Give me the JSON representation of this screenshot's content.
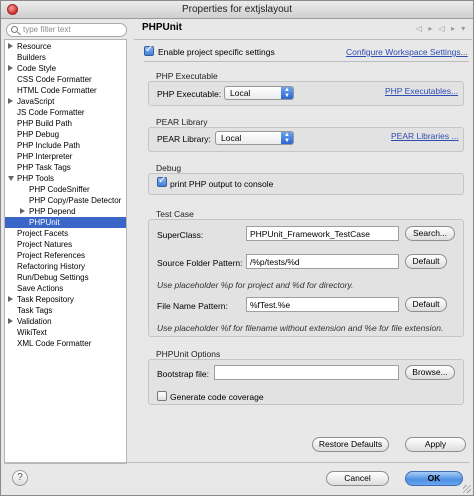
{
  "window": {
    "title": "Properties for extjslayout"
  },
  "filter": {
    "placeholder": "type filter text"
  },
  "tree": [
    {
      "label": "Resource",
      "twisty": "closed",
      "indent": 1
    },
    {
      "label": "Builders",
      "twisty": "",
      "indent": 1
    },
    {
      "label": "Code Style",
      "twisty": "closed",
      "indent": 1
    },
    {
      "label": "CSS Code Formatter",
      "twisty": "",
      "indent": 1
    },
    {
      "label": "HTML Code Formatter",
      "twisty": "",
      "indent": 1
    },
    {
      "label": "JavaScript",
      "twisty": "closed",
      "indent": 1
    },
    {
      "label": "JS Code Formatter",
      "twisty": "",
      "indent": 1
    },
    {
      "label": "PHP Build Path",
      "twisty": "",
      "indent": 1
    },
    {
      "label": "PHP Debug",
      "twisty": "",
      "indent": 1
    },
    {
      "label": "PHP Include Path",
      "twisty": "",
      "indent": 1
    },
    {
      "label": "PHP Interpreter",
      "twisty": "",
      "indent": 1
    },
    {
      "label": "PHP Task Tags",
      "twisty": "",
      "indent": 1
    },
    {
      "label": "PHP Tools",
      "twisty": "open",
      "indent": 1
    },
    {
      "label": "PHP CodeSniffer",
      "twisty": "",
      "indent": 2
    },
    {
      "label": "PHP Copy/Paste Detector",
      "twisty": "",
      "indent": 2
    },
    {
      "label": "PHP Depend",
      "twisty": "closed",
      "indent": 2
    },
    {
      "label": "PHPUnit",
      "twisty": "",
      "indent": 2,
      "selected": true
    },
    {
      "label": "Project Facets",
      "twisty": "",
      "indent": 1
    },
    {
      "label": "Project Natures",
      "twisty": "",
      "indent": 1
    },
    {
      "label": "Project References",
      "twisty": "",
      "indent": 1
    },
    {
      "label": "Refactoring History",
      "twisty": "",
      "indent": 1
    },
    {
      "label": "Run/Debug Settings",
      "twisty": "",
      "indent": 1
    },
    {
      "label": "Save Actions",
      "twisty": "",
      "indent": 1
    },
    {
      "label": "Task Repository",
      "twisty": "closed",
      "indent": 1
    },
    {
      "label": "Task Tags",
      "twisty": "",
      "indent": 1
    },
    {
      "label": "Validation",
      "twisty": "closed",
      "indent": 1
    },
    {
      "label": "WikiText",
      "twisty": "",
      "indent": 1
    },
    {
      "label": "XML Code Formatter",
      "twisty": "",
      "indent": 1
    }
  ],
  "page": {
    "title": "PHPUnit",
    "enable_specific": "Enable project specific settings",
    "configure_link": "Configure Workspace Settings...",
    "php_exec": {
      "group": "PHP Executable",
      "label": "PHP Executable:",
      "value": "Local",
      "link": "PHP Executables..."
    },
    "pear": {
      "group": "PEAR Library",
      "label": "PEAR Library:",
      "value": "Local",
      "link": "PEAR Libraries ..."
    },
    "debug": {
      "group": "Debug",
      "print_output": "print PHP output to console"
    },
    "test_case": {
      "group": "Test Case",
      "superclass_label": "SuperClass:",
      "superclass_value": "PHPUnit_Framework_TestCase",
      "search_button": "Search...",
      "source_folder_label": "Source Folder Pattern:",
      "source_folder_value": "/%p/tests/%d",
      "default_button_1": "Default",
      "source_hint": "Use placeholder %p for project and %d for directory.",
      "file_name_label": "File Name Pattern:",
      "file_name_value": "%fTest.%e",
      "default_button_2": "Default",
      "file_hint": "Use placeholder %f for filename without extension and %e for file extension."
    },
    "phpunit_options": {
      "group": "PHPUnit Options",
      "bootstrap_label": "Bootstrap file:",
      "bootstrap_value": "",
      "browse_button": "Browse...",
      "coverage": "Generate code coverage"
    },
    "restore_defaults": "Restore Defaults",
    "apply": "Apply"
  },
  "footer": {
    "help": "?",
    "cancel": "Cancel",
    "ok": "OK"
  },
  "icons": {
    "nav": "◁ ▸ ◁ ▸ ▾"
  }
}
